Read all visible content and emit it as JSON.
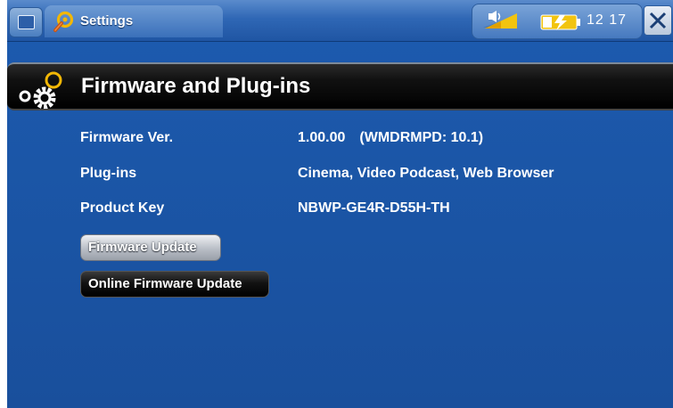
{
  "topbar": {
    "app_title": "Settings",
    "clock": "12 17"
  },
  "section": {
    "title": "Firmware and Plug-ins"
  },
  "info": [
    {
      "label": "Firmware Ver.",
      "value": "1.00.00",
      "extra": "(WMDRMPD: 10.1)"
    },
    {
      "label": "Plug-ins",
      "value": "Cinema, Video Podcast, Web Browser",
      "extra": ""
    },
    {
      "label": "Product Key",
      "value": "NBWP-GE4R-D55H-TH",
      "extra": ""
    }
  ],
  "buttons": {
    "firmware_update": "Firmware Update",
    "online_firmware_update": "Online Firmware Update"
  },
  "colors": {
    "background": "#1b56a7",
    "header_bar": "#000000",
    "accent_gear": "#f2b705"
  },
  "icons": [
    "home-icon",
    "settings-app-icon",
    "speaker-icon",
    "battery-charging-icon",
    "close-icon",
    "gears-icon"
  ]
}
